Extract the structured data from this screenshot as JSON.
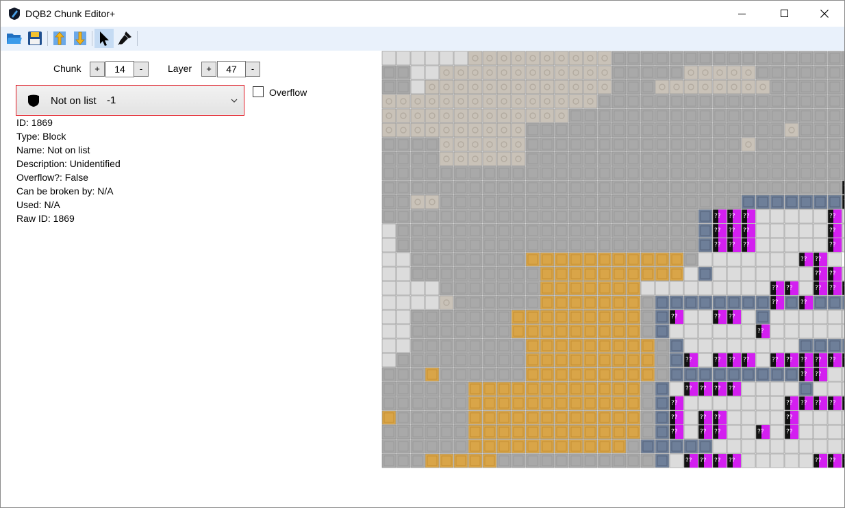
{
  "window": {
    "title": "DQB2 Chunk Editor+",
    "controls": [
      "minimize-icon",
      "maximize-icon",
      "close-icon"
    ]
  },
  "toolbar": {
    "buttons": [
      {
        "name": "open-folder-icon"
      },
      {
        "name": "save-icon"
      },
      {
        "name": "layer-up-icon"
      },
      {
        "name": "layer-down-icon"
      },
      {
        "name": "select-pointer-icon",
        "active": true
      },
      {
        "name": "paint-brush-icon"
      }
    ]
  },
  "controls": {
    "chunk_label": "Chunk",
    "chunk_value": "14",
    "layer_label": "Layer",
    "layer_value": "47",
    "plus": "+",
    "minus": "-",
    "overflow_label": "Overflow"
  },
  "block_select": {
    "name": "Not on list",
    "number": "-1"
  },
  "block_info": [
    "ID: 1869",
    "Type: Block",
    "Name: Not on list",
    "Description: Unidentified",
    "Overflow?: False",
    "Can be broken by: N/A",
    "Used: N/A",
    "Raw ID: 1869"
  ],
  "block_colors": {
    "light": "#dcdcdc",
    "stone": "#a9a9a9",
    "sandstone": "#c9c2b8",
    "orange": "#d9a548",
    "brick": "#6e7f99",
    "unknown": "#d31ff0"
  },
  "tile_grid": [
    "LLLLLLSSSSSSSSSSGGGGGGGGGGGGGGGGG",
    "GGLLSSSSSSSSSSSSGGGGGSSSSSGGGGGGG",
    "GGLSSSSSSSSSSSSSGGGSSSSSSSSGGGGGG",
    "SSSSSSSSSSSSSSSGGGGGGGGGGGGGGGGGG",
    "SSSSSSSSSSSSSGGGGGGGGGGGGGGGGGGGG",
    "SSSSSSSSSSGGGGGGGGGGGGGGGGGGSGGGG",
    "GGGGSSSSSSGGGGGGGGGGGGGGGSGGGGGGG",
    "GGGGSSSSSSGGGGGGGGGGGGGGGGGGGGGGG",
    "GGGGGGGGGGGGGGGGGGGGGGGGGGGGGGGGG",
    "GGGGGGGGGGGGGGGGGGGGGGGGGGGGGGGGU",
    "GGSSGGGGGGGGGGGGGGGGGGGGGBBBBBBBUL",
    "GGGGGGGGGGGGGGGGGGGGGGBUUULLLLLUL",
    "LGGGGGGGGGGGGGGGGGGGGGBUUULLLLLUL",
    "LGGGGGGGGGGGGGGGGGGGGGBUUULLLLLUL",
    "LLGGGGGGGGOOOOOOOOOOOGLLLLLLLUUL",
    "LLGGGGGGGGGOOOOOOOOOOLBLLLLLLLUUL",
    "LLLLGGGGGGGOOOOOOOLLLLLLLLLUULUUU",
    "LLLLSGGGGGGOOOOOOOGBBBBBBBBUBUBBB",
    "LLGGGGGGGOOOOOOOOOGBULLUULBLLLLLL",
    "LLGGGGGGGOOOOOOOOOGBLLLLLLULLLLLL",
    "LLGGGGGGGGOOOOOOOOOGBLLLLLLLLBBBBB",
    "LGGGGGGGGGOOOOOOOOOGBULUUULUUUUUU",
    "GGGOGGGGGGOOOOOOOOOGBBBBBBBBBUULL",
    "GGGGGGOOOOOOOOOOOOGBLUUUULLLLBLLL",
    "GGGGGGOOOOOOOOOOOOGBULLLLLLLUUUUU",
    "OGGGGGOOOOOOOOOOOOGBULUULLLLULLLL",
    "GGGGGGOOOOOOOOOOOOGBULUULLULULLLL",
    "GGGGGGOOOOOOOOOOOGBBBBBLLLLLLLLLL",
    "GGGOOOOOGGGGGGGGGGGBLUUUULLLLLUUU"
  ]
}
